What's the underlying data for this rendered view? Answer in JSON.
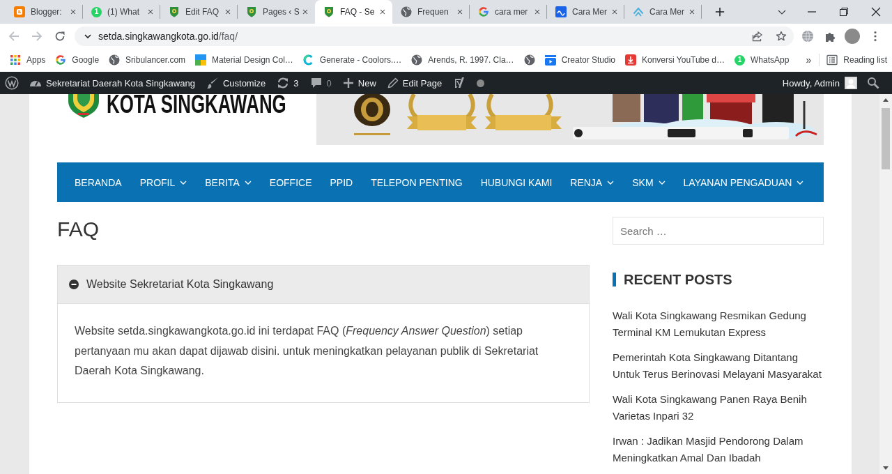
{
  "browser": {
    "tabs": [
      {
        "title": "Blogger:",
        "kind": "blogger",
        "selected": false
      },
      {
        "title": "(1) What",
        "kind": "whatsapp",
        "badge": "1",
        "selected": false
      },
      {
        "title": "Edit FAQ",
        "kind": "emblem",
        "selected": false
      },
      {
        "title": "Pages ‹ S",
        "kind": "emblem",
        "selected": false
      },
      {
        "title": "FAQ - Se",
        "kind": "emblem",
        "selected": true
      },
      {
        "title": "Frequen",
        "kind": "globe",
        "selected": false
      },
      {
        "title": "cara mer",
        "kind": "google",
        "selected": false
      },
      {
        "title": "Cara Mer",
        "kind": "wave",
        "selected": false
      },
      {
        "title": "Cara Mer",
        "kind": "arch",
        "selected": false
      }
    ],
    "address": {
      "host": "setda.singkawangkota.go.id",
      "path": "/faq/"
    },
    "bookmarks": [
      {
        "label": "Apps",
        "kind": "apps"
      },
      {
        "label": "Google",
        "kind": "google"
      },
      {
        "label": "Sribulancer.com",
        "kind": "globe"
      },
      {
        "label": "Material Design Col…",
        "kind": "squares"
      },
      {
        "label": "Generate - Coolors.…",
        "kind": "ring"
      },
      {
        "label": "Arends, R. 1997. Cla…",
        "kind": "globe"
      },
      {
        "kind": "globe"
      },
      {
        "label": "Creator Studio",
        "kind": "clapper"
      },
      {
        "label": "Konversi YouTube d…",
        "kind": "download"
      },
      {
        "label": "WhatsApp",
        "kind": "whatsapp",
        "badge": "1"
      }
    ],
    "overflow": "»",
    "reading_list": "Reading list"
  },
  "admin_bar": {
    "items": [
      {
        "kind": "logo"
      },
      {
        "kind": "site",
        "label": "Sekretariat Daerah Kota Singkawang"
      },
      {
        "kind": "customize",
        "label": "Customize"
      },
      {
        "kind": "updates",
        "label": "3"
      },
      {
        "kind": "comments",
        "label": "0"
      },
      {
        "kind": "new",
        "label": "New"
      },
      {
        "kind": "edit",
        "label": "Edit Page"
      },
      {
        "kind": "seo"
      },
      {
        "kind": "status"
      }
    ],
    "greeting": "Howdy, Admin"
  },
  "site": {
    "title": "KOTA SINGKAWANG",
    "nav": [
      {
        "label": "BERANDA",
        "submenu": false
      },
      {
        "label": "PROFIL",
        "submenu": true
      },
      {
        "label": "BERITA",
        "submenu": true
      },
      {
        "label": "EOFFICE",
        "submenu": false
      },
      {
        "label": "PPID",
        "submenu": false
      },
      {
        "label": "TELEPON PENTING",
        "submenu": false
      },
      {
        "label": "HUBUNGI KAMI",
        "submenu": false
      },
      {
        "label": "RENJA",
        "submenu": true
      },
      {
        "label": "SKM",
        "submenu": true
      },
      {
        "label": "LAYANAN PENGADUAN",
        "submenu": true
      }
    ],
    "page_title": "FAQ",
    "faq": [
      {
        "question": "Website Sekretariat Kota Singkawang",
        "answer": "Website setda.singkawangkota.go.id ini terdapat FAQ (*Frequency Answer Question*) setiap pertanyaan mu akan dapat dijawab disini. untuk meningkatkan pelayanan publik di Sekretariat Daerah Kota Singkawang.",
        "expanded": true
      }
    ],
    "search": {
      "placeholder": "Search …"
    },
    "recent_posts": {
      "heading": "RECENT POSTS",
      "items": [
        "Wali Kota Singkawang Resmikan Gedung Terminal KM Lemukutan Express",
        "Pemerintah Kota Singkawang Ditantang Untuk Terus Berinovasi Melayani Masyarakat",
        "Wali Kota Singkawang Panen Raya Benih Varietas Inpari 32",
        "Irwan : Jadikan Masjid Pendorong Dalam Meningkatkan Amal Dan Ibadah"
      ]
    }
  }
}
